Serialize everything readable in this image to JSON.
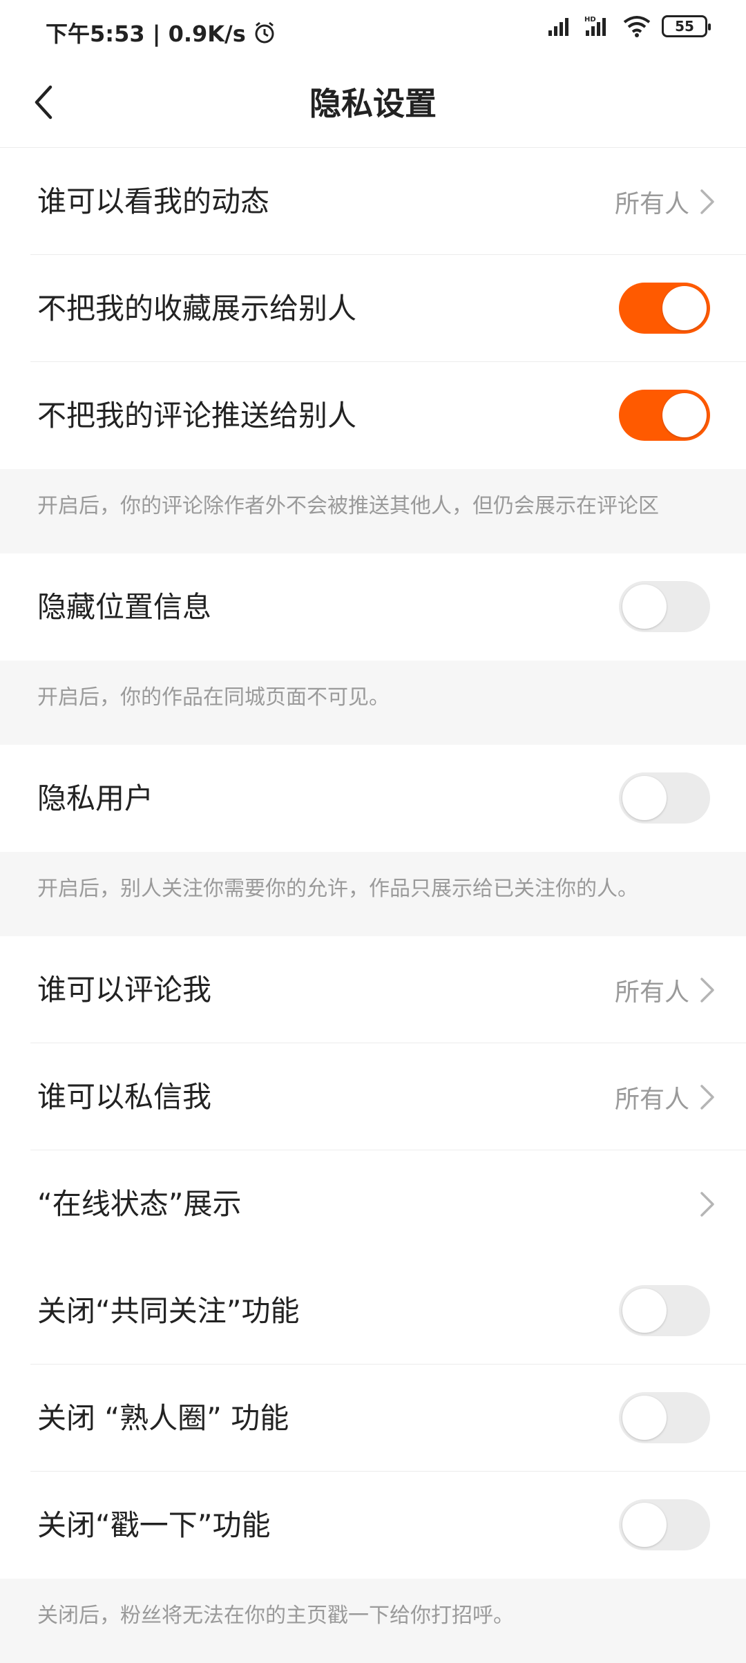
{
  "status_bar": {
    "time_and_speed": "下午5:53 | 0.9K/s",
    "battery": "55"
  },
  "nav": {
    "title": "隐私设置"
  },
  "rows": [
    {
      "label": "谁可以看我的动态",
      "value": "所有人"
    },
    {
      "label": "不把我的收藏展示给别人",
      "toggle": "on"
    },
    {
      "label": "不把我的评论推送给别人",
      "toggle": "on"
    },
    {
      "note": "开启后，你的评论除作者外不会被推送其他人，但仍会展示在评论区"
    },
    {
      "label": "隐藏位置信息",
      "toggle": "off"
    },
    {
      "note": "开启后，你的作品在同城页面不可见。"
    },
    {
      "label": "隐私用户",
      "toggle": "off"
    },
    {
      "note": "开启后，别人关注你需要你的允许，作品只展示给已关注你的人。"
    },
    {
      "label": "谁可以评论我",
      "value": "所有人"
    },
    {
      "label": "谁可以私信我",
      "value": "所有人"
    },
    {
      "label": "“在线状态”展示"
    },
    {
      "label": "关闭“共同关注”功能",
      "toggle": "off"
    },
    {
      "label": "关闭 “熟人圈” 功能",
      "toggle": "off"
    },
    {
      "label": "关闭“戳一下”功能",
      "toggle": "off"
    },
    {
      "note": "关闭后，粉丝将无法在你的主页戳一下给你打招呼。"
    }
  ],
  "colors": {
    "accent": "#ff5a00",
    "toggle_off": "#ebebeb"
  }
}
